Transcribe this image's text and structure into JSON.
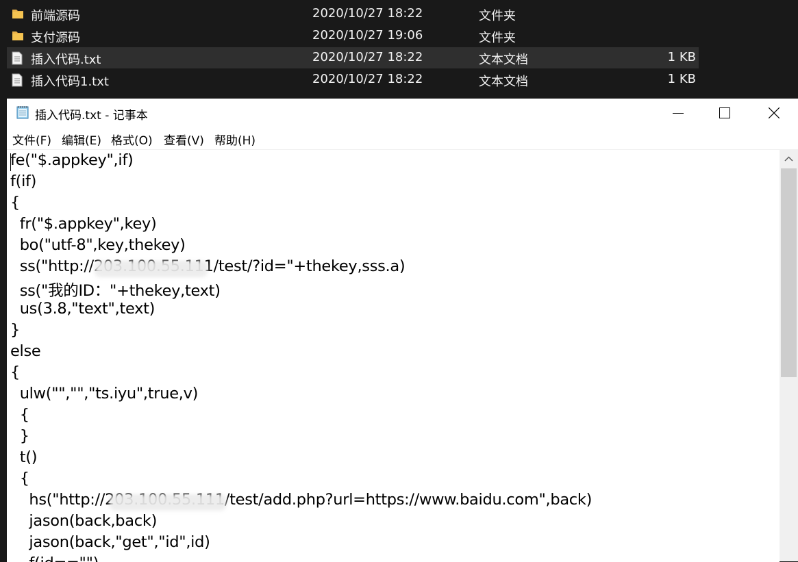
{
  "explorer": {
    "files": [
      {
        "name": "前端源码",
        "date": "2020/10/27 18:22",
        "type": "文件夹",
        "size": "",
        "icon": "folder-icon"
      },
      {
        "name": "支付源码",
        "date": "2020/10/27 19:06",
        "type": "文件夹",
        "size": "",
        "icon": "folder-icon"
      },
      {
        "name": "插入代码.txt",
        "date": "2020/10/27 18:22",
        "type": "文本文档",
        "size": "1 KB",
        "icon": "text-document-icon"
      },
      {
        "name": "插入代码1.txt",
        "date": "2020/10/27 18:22",
        "type": "文本文档",
        "size": "1 KB",
        "icon": "text-document-icon"
      }
    ]
  },
  "notepad": {
    "title": "插入代码.txt - 记事本",
    "icon": "notepad-icon",
    "window_buttons": {
      "minimize": "minimize-icon",
      "maximize": "maximize-icon",
      "close": "close-icon"
    },
    "menu": [
      "文件(F)",
      "编辑(E)",
      "格式(O)",
      "查看(V)",
      "帮助(H)"
    ],
    "lines": [
      "fe(\"$.appkey\",if)",
      "f(if)",
      "{",
      "  fr(\"$.appkey\",key)",
      "  bo(\"utf-8\",key,thekey)",
      "  ss(\"http://203.100.55.111/test/?id=\"+thekey,sss.a)",
      "  ss(\"我的ID：\"+thekey,text)",
      "  us(3.8,\"text\",text)",
      "}",
      "else",
      "{",
      "  ulw(\"\",\"\",\"ts.iyu\",true,v)",
      "  {",
      "  }",
      "  t()",
      "  {",
      "    hs(\"http://203.100.55.111/test/add.php?url=https://www.baidu.com\",back)",
      "    jason(back,back)",
      "    jason(back,\"get\",\"id\",id)",
      "    f(id==\"\")"
    ]
  },
  "colors": {
    "explorer_bg": "#191919",
    "selected_row": "#2f2f2f",
    "folder": "#e8b14a",
    "scrollbar": "#f0f0f0",
    "thumb": "#cdcdcd"
  }
}
